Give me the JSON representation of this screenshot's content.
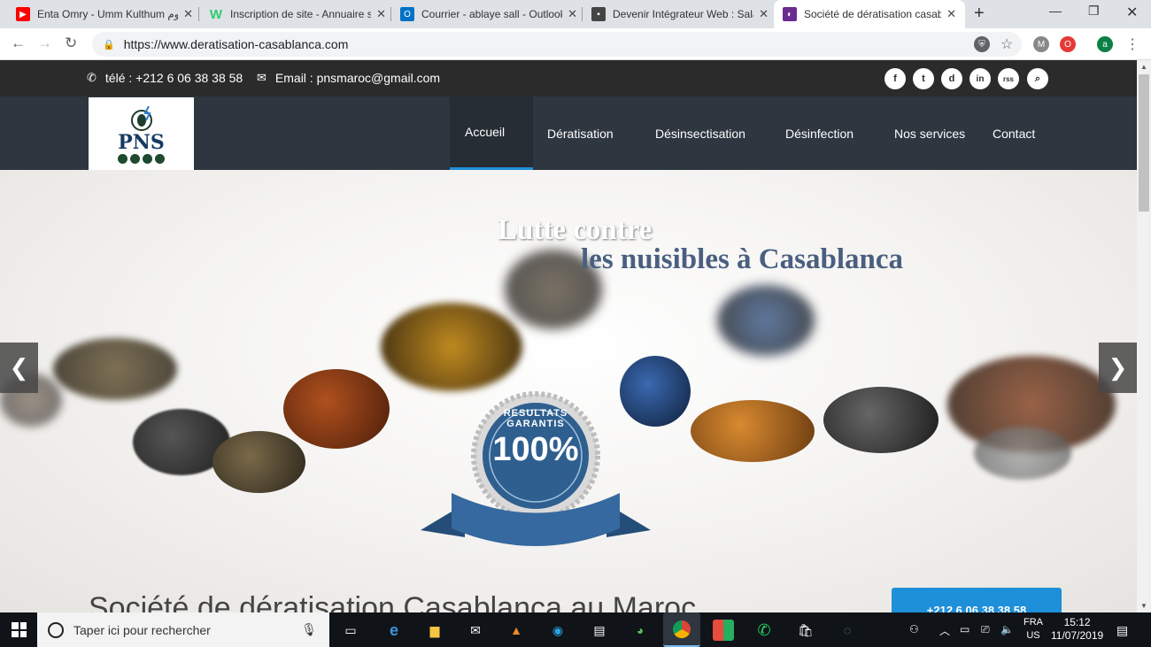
{
  "browser": {
    "tabs": [
      {
        "title": "Enta Omry - Umm Kulthum موم",
        "icon": "youtube-icon",
        "color": "#ff0000"
      },
      {
        "title": "Inscription de site - Annuaire s",
        "icon": "w-icon",
        "color": "#2ecc71"
      },
      {
        "title": "Courrier - ablaye sall - Outlook",
        "icon": "outlook-icon",
        "color": "#0072c6"
      },
      {
        "title": "Devenir Intégrateur Web : Sala",
        "icon": "page-icon",
        "color": "#444444"
      },
      {
        "title": "Société de dératisation casabla",
        "icon": "site-icon",
        "color": "#6a2c91"
      }
    ],
    "url": "https://www.deratisation-casablanca.com"
  },
  "site": {
    "phone_label": "télé : +212 6 06 38 38 58",
    "email_label": "Email : pnsmaroc@gmail.com",
    "social": [
      "f",
      "t",
      "d",
      "in",
      "rss",
      "search"
    ],
    "logo_text": "PNS",
    "menu": [
      "Accueil",
      "Dératisation",
      "Désinsectisation",
      "Désinfection",
      "Nos services",
      "Contact"
    ],
    "hero": {
      "line1": "Lutte contre",
      "line2": "les nuisibles à Casablanca",
      "seal_top": "RESULTATS GARANTIS",
      "seal_value": "100%"
    },
    "heading": "Société de dératisation Casablanca au Maroc",
    "call_button": "+212 6 06 38 38 58",
    "colors": {
      "accent": "#1e8fd9",
      "topbar": "#2b2b2b",
      "navbar": "#2e3640",
      "title_blue": "#4a5f80"
    }
  },
  "taskbar": {
    "search_placeholder": "Taper ici pour rechercher",
    "lang1": "FRA",
    "lang2": "US",
    "time": "15:12",
    "date": "11/07/2019"
  }
}
